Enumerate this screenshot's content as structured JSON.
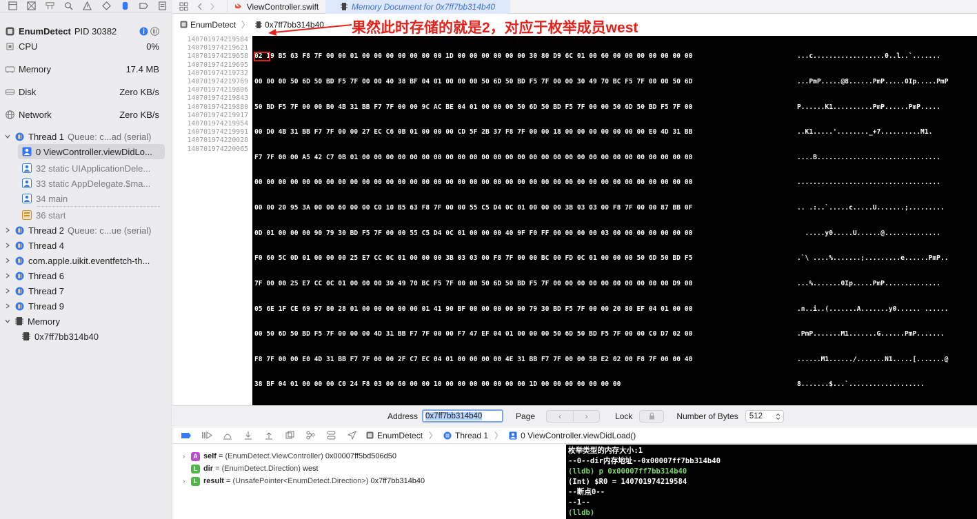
{
  "process": {
    "name": "EnumDetect",
    "pid": "PID 30382"
  },
  "gauges": [
    {
      "label": "CPU",
      "value": "0%"
    },
    {
      "label": "Memory",
      "value": "17.4 MB"
    },
    {
      "label": "Disk",
      "value": "Zero KB/s"
    },
    {
      "label": "Network",
      "value": "Zero KB/s"
    }
  ],
  "threads": {
    "t1": {
      "name": "Thread 1",
      "queue": "Queue: c...ad (serial)"
    },
    "frames": [
      "0 ViewController.viewDidLo...",
      "32 static UIApplicationDele...",
      "33 static AppDelegate.$ma...",
      "34 main",
      "36 start"
    ],
    "t2": {
      "name": "Thread 2",
      "queue": "Queue: c...ue (serial)"
    },
    "others": [
      "Thread 4",
      "com.apple.uikit.eventfetch-th...",
      "Thread 6",
      "Thread 7",
      "Thread 9"
    ],
    "memory_group": "Memory",
    "memory_item": "0x7ff7bb314b40"
  },
  "tabs": [
    {
      "label": "ViewController.swift"
    },
    {
      "label": "Memory Document for 0x7ff7bb314b40"
    }
  ],
  "path": {
    "project": "EnumDetect",
    "doc": "0x7ff7bb314b40"
  },
  "annotation": "果然此时存储的就是2，对应于枚举成员west",
  "memory": {
    "addresses": [
      "140701974219584",
      "140701974219621",
      "140701974219658",
      "140701974219695",
      "140701974219732",
      "140701974219769",
      "140701974219806",
      "140701974219843",
      "140701974219880",
      "140701974219917",
      "140701974219954",
      "140701974219991",
      "140701974220028",
      "140701974220065"
    ],
    "hex_first": "02",
    "hex_rows": [
      " 19 B5 63 F8 7F 00 00 01 00 00 00 00 00 00 00 1D 00 00 00 00 00 00 30 80 D9 6C 01 00 60 00 00 00 00 00 00 00",
      "00 00 00 50 6D 50 BD F5 7F 00 00 40 38 BF 04 01 00 00 00 50 6D 50 BD F5 7F 00 00 30 49 70 BC F5 7F 00 00 50 6D",
      "50 BD F5 7F 00 00 B0 4B 31 BB F7 7F 00 00 9C AC BE 04 01 00 00 00 50 6D 50 BD F5 7F 00 00 50 6D 50 BD F5 7F 00",
      "00 D0 4B 31 BB F7 7F 00 00 27 EC C6 0B 01 00 00 00 CD 5F 2B 37 F8 7F 00 00 18 00 00 00 00 00 00 00 E0 4D 31 BB",
      "F7 7F 00 00 A5 42 C7 0B 01 00 00 00 00 00 00 00 00 00 00 00 00 00 00 00 00 00 00 00 00 00 00 00 00 00 00 00 00",
      "00 00 00 00 00 00 00 00 00 00 00 00 00 00 00 00 00 00 00 00 00 00 00 00 00 00 00 00 00 00 00 00 00 00 00 00 00",
      "00 00 20 95 3A 00 00 60 00 00 C0 10 B5 63 F8 7F 00 00 55 C5 D4 0C 01 00 00 00 3B 03 03 00 F8 7F 00 00 87 BB 0F",
      "0D 01 00 00 00 90 79 30 BD F5 7F 00 00 55 C5 D4 0C 01 00 00 00 40 9F F0 FF 00 00 00 00 03 00 00 00 00 00 00 00",
      "F0 60 5C 0D 01 00 00 00 25 E7 CC 0C 01 00 00 00 3B 03 03 00 F8 7F 00 00 BC 00 FD 0C 01 00 00 00 50 6D 50 BD F5",
      "7F 00 00 25 E7 CC 0C 01 00 00 00 30 49 70 BC F5 7F 00 00 50 6D 50 BD F5 7F 00 00 00 00 00 00 00 00 00 00 D9 00",
      "05 6E 1F CE 69 97 80 28 01 00 00 00 00 00 01 41 90 BF 00 00 00 00 90 79 30 BD F5 7F 00 00 20 80 EF 04 01 00 00",
      "00 50 6D 50 BD F5 7F 00 00 00 4D 31 BB F7 7F 00 00 F7 47 EF 04 01 00 00 00 50 6D 50 BD F5 7F 00 00 C0 D7 02 00",
      "F8 7F 00 00 E0 4D 31 BB F7 7F 00 00 2F C7 EC 04 01 00 00 00 00 4E 31 BB F7 7F 00 00 5B E2 02 00 F8 7F 00 00 40",
      "38 BF 04 01 00 00 00 C0 24 F8 03 00 60 00 00 10 00 00 00 00 00 00 00 1D 00 00 00 00 00 00 00"
    ],
    "ascii_rows": [
      "...c..................0..l..`.......",
      "...PmP.....@8......PmP.....0Ip.....PmP",
      "P......K1..........PmP......PmP.....",
      "..K1.....'........_+7..........M1.",
      "....B...............................",
      "....................................",
      ".. .:..`.....c.....U.......;.........",
      "  .....y0.....U......@..............",
      ".`\\ ....%.......;.........e......PmP..",
      "...%.......0Ip.....PmP..............",
      ".n..i..(.......A.......y0...... ......",
      ".PmP.......M1.......G......PmP.......",
      "......M1....../.......N1.....[.......@",
      "8.......$...`..................."
    ]
  },
  "memctl": {
    "address_label": "Address",
    "address_value": "0x7ff7bb314b40",
    "page_label": "Page",
    "lock_label": "Lock",
    "bytes_label": "Number of Bytes",
    "bytes_value": "512"
  },
  "debugbar": {
    "project": "EnumDetect",
    "thread": "Thread 1",
    "frame": "0 ViewController.viewDidLoad()"
  },
  "variables": [
    {
      "badge": "A",
      "badge_color": "#b94ed3",
      "name": "self",
      "type": "(EnumDetect.ViewController)",
      "value": "0x00007ff5bd506d50",
      "expandable": true
    },
    {
      "badge": "L",
      "badge_color": "#4fb74a",
      "name": "dir",
      "type": "(EnumDetect.Direction)",
      "value": "west",
      "expandable": false
    },
    {
      "badge": "L",
      "badge_color": "#4fb74a",
      "name": "result",
      "type": "(UnsafePointer<EnumDetect.Direction>)",
      "value": "0x7ff7bb314b40",
      "expandable": true
    }
  ],
  "console": [
    "枚举类型的内存大小:1",
    "--0--dir内存地址--0x00007ff7bb314b40",
    "(lldb) p 0x00007ff7bb314b40",
    "(Int) $R0 = 140701974219584",
    "--断点0--",
    "--1--",
    "(lldb)"
  ],
  "colors": {
    "annotation": "#e4211a",
    "selection_blue": "#3d6fd2",
    "thread_icon": "#3478f6",
    "console_prompt": "#7bd46b"
  }
}
